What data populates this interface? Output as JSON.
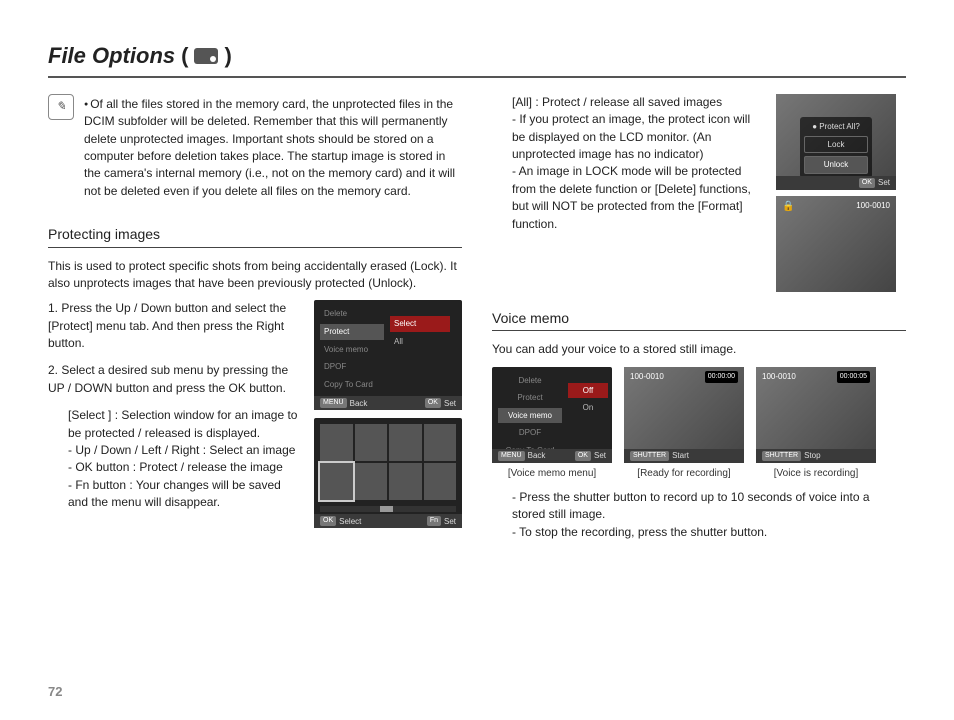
{
  "title": "File Options",
  "paren_open": "(",
  "paren_close": ")",
  "title_icon_name": "camera-mode-icon",
  "note_icon_glyph": "✎",
  "note_text": "Of all the files stored in the memory card, the unprotected files in the DCIM subfolder will be deleted. Remember that this will permanently delete unprotected images. Important shots should be stored on a computer before deletion takes place. The startup image is stored in the camera's internal memory (i.e., not on the memory card) and it will not be deleted even if you delete all files on the memory card.",
  "sec_protect_h": "Protecting images",
  "sec_protect_intro": "This is used to protect specific shots from being accidentally erased (Lock). It also unprotects images that have been previously protected (Unlock).",
  "step1": "1. Press the Up / Down button and select the [Protect] menu tab. And then press the Right button.",
  "step2": "2. Select a desired sub menu by pressing the UP / DOWN button and press the OK button.",
  "step2_sel_head": "[Select ] : Selection window for an image to be protected / released is displayed.",
  "step2_sel_1": "- Up / Down / Left / Right : Select an image",
  "step2_sel_2": "- OK button : Protect / release the image",
  "step2_sel_3": "- Fn button : Your changes will be saved and the menu will disappear.",
  "all_head": "[All] : Protect / release all saved images",
  "all_1": "- If you protect an image, the protect icon will be displayed on the LCD monitor. (An unprotected image has no indicator)",
  "all_2": "- An image in LOCK mode will be protected from the delete function or [Delete] functions, but will NOT be protected from the [Format] function.",
  "sec_voice_h": "Voice memo",
  "voice_intro": "You can add your voice to a stored still image.",
  "voice_b1": "- Press the shutter button to record up to 10 seconds of voice into a stored still image.",
  "voice_b2": "- To stop the recording, press the shutter button.",
  "captions": {
    "c1": "[Voice memo menu]",
    "c2": "[Ready for recording]",
    "c3": "[Voice is recording]"
  },
  "menu": {
    "items": [
      "Delete",
      "Protect",
      "Voice memo",
      "DPOF",
      "Copy To Card"
    ],
    "sub_select": "Select",
    "sub_all": "All",
    "voice_off": "Off",
    "voice_on": "On"
  },
  "foot": {
    "back": "Back",
    "set": "Set",
    "select": "Select",
    "start": "Start",
    "stop": "Stop",
    "menu_k": "MENU",
    "ok_k": "OK",
    "fn_k": "Fn",
    "shutter_k": "SHUTTER"
  },
  "popup": {
    "title": "Protect All?",
    "lock": "Lock",
    "unlock": "Unlock"
  },
  "osd": {
    "filecount": "100-0010",
    "time0": "00:00:00",
    "time1": "00:00:05"
  },
  "page_number": "72"
}
